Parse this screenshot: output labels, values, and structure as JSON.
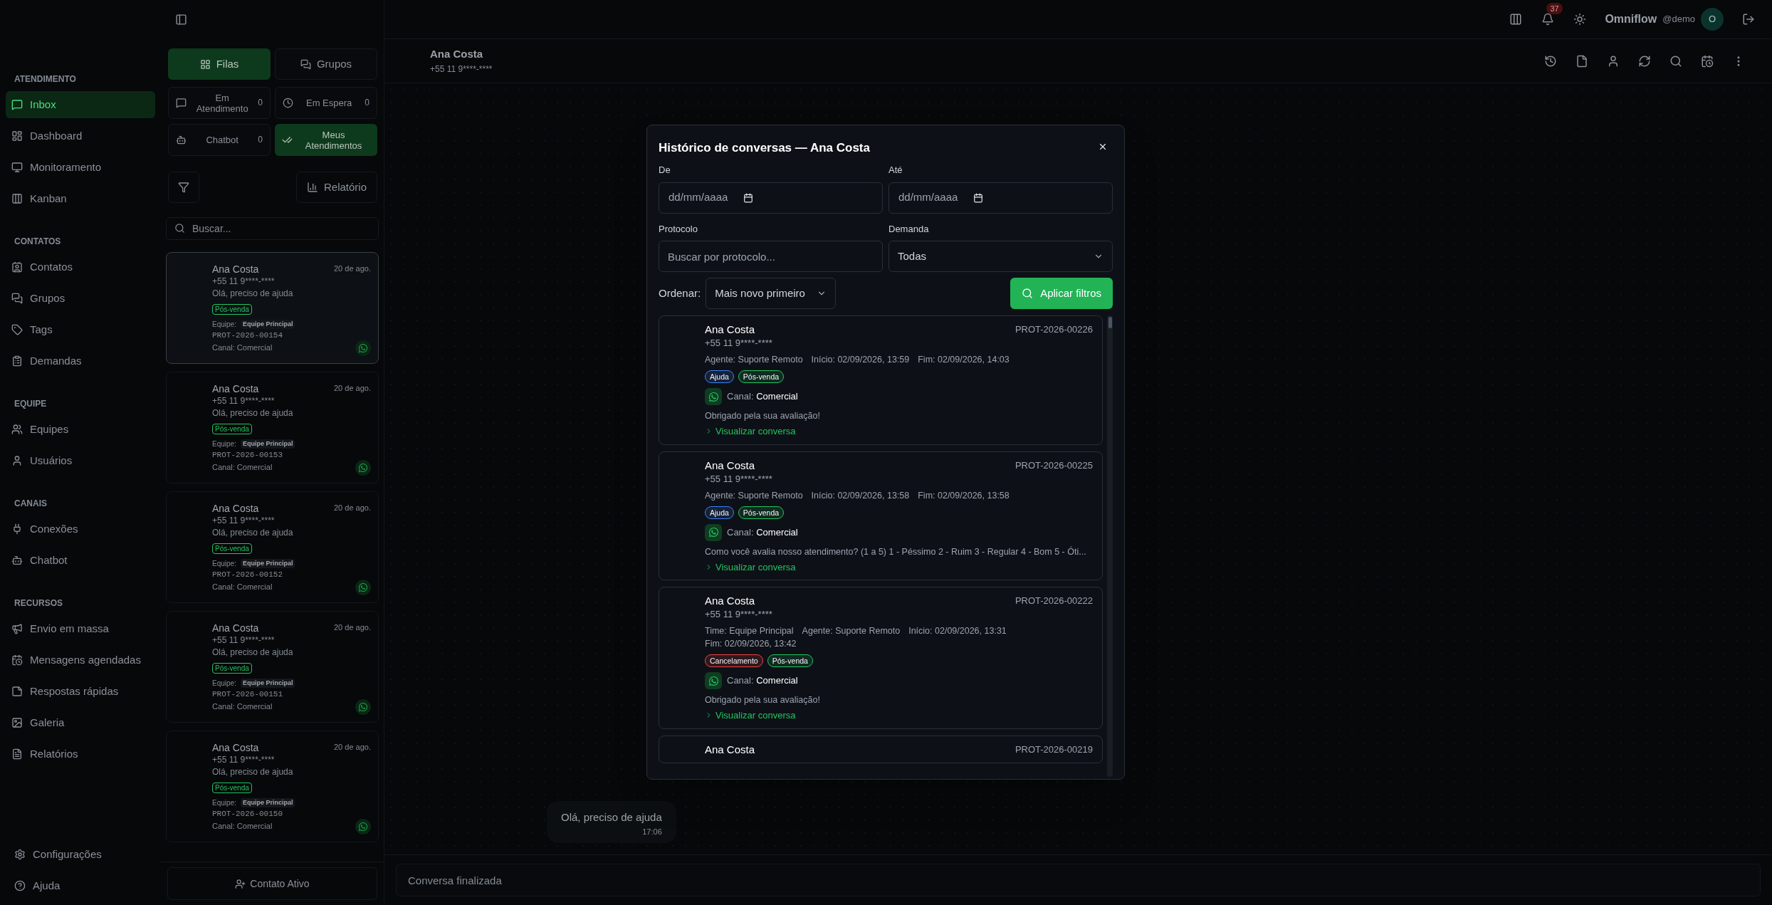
{
  "sidebar": {
    "sections": [
      {
        "title": "ATENDIMENTO",
        "items": [
          {
            "label": "Inbox",
            "selected": true
          },
          {
            "label": "Dashboard",
            "selected": false
          },
          {
            "label": "Monitoramento",
            "selected": false
          },
          {
            "label": "Kanban",
            "selected": false
          }
        ]
      },
      {
        "title": "CONTATOS",
        "items": [
          {
            "label": "Contatos",
            "selected": false
          },
          {
            "label": "Grupos",
            "selected": false
          },
          {
            "label": "Tags",
            "selected": false
          },
          {
            "label": "Demandas",
            "selected": false
          }
        ]
      },
      {
        "title": "EQUIPE",
        "items": [
          {
            "label": "Equipes",
            "selected": false
          },
          {
            "label": "Usuários",
            "selected": false
          }
        ]
      },
      {
        "title": "CANAIS",
        "items": [
          {
            "label": "Conexões",
            "selected": false
          },
          {
            "label": "Chatbot",
            "selected": false
          }
        ]
      },
      {
        "title": "RECURSOS",
        "items": [
          {
            "label": "Envio em massa",
            "selected": false
          },
          {
            "label": "Mensagens agendadas",
            "selected": false
          },
          {
            "label": "Respostas rápidas",
            "selected": false
          },
          {
            "label": "Galeria",
            "selected": false
          },
          {
            "label": "Relatórios",
            "selected": false
          }
        ]
      }
    ],
    "footer": [
      "Configurações",
      "Ajuda"
    ]
  },
  "topbar": {
    "notifications": "37",
    "brand": "Omniflow",
    "username": "@demo",
    "avatar": "O"
  },
  "list_panel": {
    "tabs": [
      {
        "label": "Filas",
        "selected": true
      },
      {
        "label": "Grupos",
        "selected": false
      }
    ],
    "status_filters": [
      {
        "label": "Em Atendimento",
        "count": "0",
        "selected": false
      },
      {
        "label": "Em Espera",
        "count": "0",
        "selected": false
      },
      {
        "label": "Chatbot",
        "count": "0",
        "selected": false
      },
      {
        "label": "Meus Atendimentos",
        "selected": true
      }
    ],
    "report_button": "Relatório",
    "search": {
      "placeholder": "Buscar..."
    },
    "conversations": [
      {
        "name": "Ana Costa",
        "date": "20 de ago.",
        "phone": "+55 11 9****-****",
        "preview": "Olá, preciso de ajuda",
        "tag": {
          "label": "Pós-venda",
          "color": "#22c55e"
        },
        "team_label": "Equipe:",
        "team": "Equipe Principal",
        "protocol": "PROT-2026-00154",
        "channel": "Canal: Comercial",
        "selected": true
      },
      {
        "name": "Ana Costa",
        "date": "20 de ago.",
        "phone": "+55 11 9****-****",
        "preview": "Olá, preciso de ajuda",
        "tag": {
          "label": "Pós-venda",
          "color": "#22c55e"
        },
        "team_label": "Equipe:",
        "team": "Equipe Principal",
        "protocol": "PROT-2026-00153",
        "channel": "Canal: Comercial",
        "selected": false
      },
      {
        "name": "Ana Costa",
        "date": "20 de ago.",
        "phone": "+55 11 9****-****",
        "preview": "Olá, preciso de ajuda",
        "tag": {
          "label": "Pós-venda",
          "color": "#22c55e"
        },
        "team_label": "Equipe:",
        "team": "Equipe Principal",
        "protocol": "PROT-2026-00152",
        "channel": "Canal: Comercial",
        "selected": false
      },
      {
        "name": "Ana Costa",
        "date": "20 de ago.",
        "phone": "+55 11 9****-****",
        "preview": "Olá, preciso de ajuda",
        "tag": {
          "label": "Pós-venda",
          "color": "#22c55e"
        },
        "team_label": "Equipe:",
        "team": "Equipe Principal",
        "protocol": "PROT-2026-00151",
        "channel": "Canal: Comercial",
        "selected": false
      },
      {
        "name": "Ana Costa",
        "date": "20 de ago.",
        "phone": "+55 11 9****-****",
        "preview": "Olá, preciso de ajuda",
        "tag": {
          "label": "Pós-venda",
          "color": "#22c55e"
        },
        "team_label": "Equipe:",
        "team": "Equipe Principal",
        "protocol": "PROT-2026-00150",
        "channel": "Canal: Comercial",
        "selected": false
      }
    ],
    "new_contact_button": "Contato Ativo"
  },
  "chat": {
    "name": "Ana Costa",
    "phone": "+55 11 9****-****",
    "messages": [
      {
        "text": "Olá, preciso de ajuda",
        "time": "17:06"
      }
    ],
    "input": {
      "placeholder": "Conversa finalizada"
    }
  },
  "modal": {
    "title": "Histórico de conversas — Ana Costa",
    "from": {
      "label": "De",
      "placeholder": "dd/mm/aaaa"
    },
    "to": {
      "label": "Até",
      "placeholder": "dd/mm/aaaa"
    },
    "protocol": {
      "label": "Protocolo",
      "placeholder": "Buscar por protocolo..."
    },
    "demand": {
      "label": "Demanda",
      "value": "Todas"
    },
    "sort": {
      "label": "Ordenar:",
      "value": "Mais novo primeiro"
    },
    "apply_button": "Aplicar filtros",
    "results": [
      {
        "name": "Ana Costa",
        "protocol": "PROT-2026-00226",
        "phone": "+55 11 9****-****",
        "meta": [
          "Agente: Suporte Remoto",
          "Início: 02/09/2026, 13:59",
          "Fim: 02/09/2026, 14:03"
        ],
        "tags": [
          {
            "label": "Ajuda",
            "color": "#3b82f6"
          },
          {
            "label": "Pós-venda",
            "color": "#22c55e"
          }
        ],
        "channel": "Canal: **Comercial**",
        "message": "Obrigado pela sua avaliação!",
        "link": "Visualizar conversa"
      },
      {
        "name": "Ana Costa",
        "protocol": "PROT-2026-00225",
        "phone": "+55 11 9****-****",
        "meta": [
          "Agente: Suporte Remoto",
          "Início: 02/09/2026, 13:58",
          "Fim: 02/09/2026, 13:58"
        ],
        "tags": [
          {
            "label": "Ajuda",
            "color": "#3b82f6"
          },
          {
            "label": "Pós-venda",
            "color": "#22c55e"
          }
        ],
        "channel": "Canal: **Comercial**",
        "message": "Como você avalia nosso atendimento? (1 a 5) 1 - Péssimo 2 - Ruim 3 - Regular 4 - Bom 5 - Óti...",
        "link": "Visualizar conversa"
      },
      {
        "name": "Ana Costa",
        "protocol": "PROT-2026-00222",
        "phone": "+55 11 9****-****",
        "meta": [
          "Time: Equipe Principal",
          "Agente: Suporte Remoto",
          "Início: 02/09/2026, 13:31",
          "Fim: 02/09/2026, 13:42"
        ],
        "tags": [
          {
            "label": "Cancelamento",
            "color": "#ef4444"
          },
          {
            "label": "Pós-venda",
            "color": "#22c55e"
          }
        ],
        "channel": "Canal: **Comercial**",
        "message": "Obrigado pela sua avaliação!",
        "link": "Visualizar conversa"
      },
      {
        "name": "Ana Costa",
        "protocol": "PROT-2026-00219"
      }
    ]
  }
}
